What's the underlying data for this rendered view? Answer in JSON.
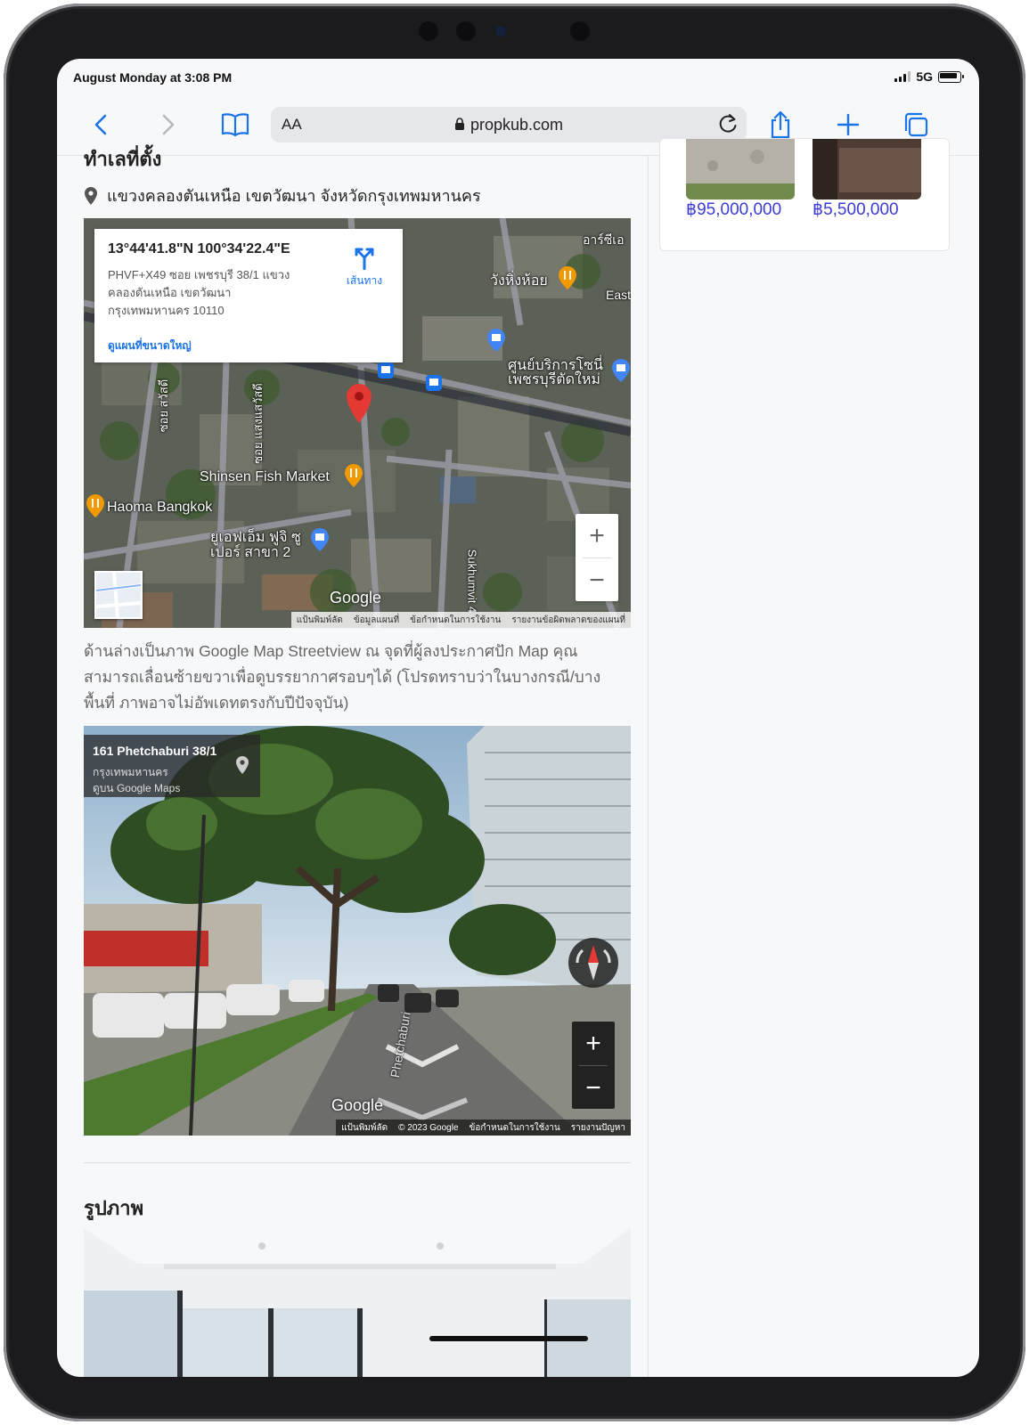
{
  "status": {
    "time": "August Monday at 3:08 PM",
    "network": "5G"
  },
  "browser": {
    "reader_label": "AA",
    "url": "propkub.com"
  },
  "location": {
    "heading": "ทำเลที่ตั้ง",
    "address": "แขวงคลองตันเหนือ เขตวัฒนา จังหวัดกรุงเทพมหานคร"
  },
  "map": {
    "coordinates": "13°44'41.8\"N 100°34'22.4\"E",
    "plus_code_address": "PHVF+X49 ซอย เพชรบุรี 38/1 แขวง คลองตันเหนือ เขตวัฒนา กรุงเทพมหานคร 10110",
    "directions_label": "เส้นทาง",
    "larger_map_label": "ดูแผนที่ขนาดใหญ่",
    "places": [
      "Shinsen Fish Market",
      "Haoma Bangkok",
      "วังหิ่งห้อย",
      "ศูนย์บริการโซนี่ เพชรบุรีตัดใหม่",
      "ยูเอฟเอ็ม ฟูจิ ซูเปอร์ สาขา 2",
      "Sukhumvit 4",
      "ซอย สวัสดี",
      "ซอย แสงแสวัสดี",
      "อาร์ซีเอ",
      "East"
    ],
    "google_label": "Google",
    "attribution": [
      "แป้นพิมพ์ลัด",
      "ข้อมูลแผนที่",
      "ข้อกำหนดในการใช้งาน",
      "รายงานข้อผิดพลาดของแผนที่"
    ]
  },
  "description": "ด้านล่างเป็นภาพ Google Map Streetview ณ จุดที่ผู้ลงประกาศปัก Map คุณสามารถเลื่อนซ้ายขวาเพื่อดูบรรยากาศรอบๆได้ (โปรดทราบว่าในบางกรณี/บางพื้นที่ ภาพอาจไม่อัพเดทตรงกับปีปัจจุบัน)",
  "streetview": {
    "place": "161 Phetchaburi 38/1",
    "city": "กรุงเทพมหานคร",
    "view_on_maps": "ดูบน Google Maps",
    "google_label": "Google",
    "road_label": "Phetchaburi",
    "attribution": [
      "แป้นพิมพ์ลัด",
      "© 2023 Google",
      "ข้อกำหนดในการใช้งาน",
      "รายงานปัญหา"
    ]
  },
  "photos": {
    "heading": "รูปภาพ"
  },
  "related": {
    "prices": [
      "฿95,000,000",
      "฿5,500,000"
    ]
  },
  "zoom": {
    "plus": "+",
    "minus": "−"
  }
}
